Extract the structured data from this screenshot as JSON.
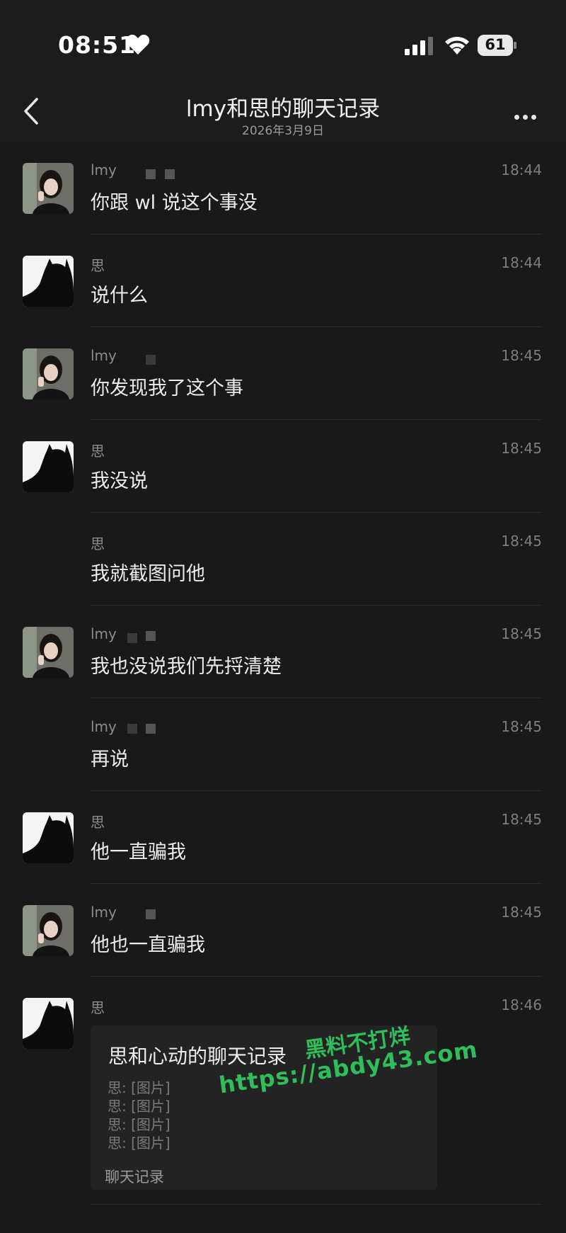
{
  "status_bar": {
    "time": "08:51",
    "battery": "61"
  },
  "header": {
    "title": "lmy和思的聊天记录",
    "date": "2026年3月9日"
  },
  "messages": [
    {
      "sender": "lmy",
      "time": "18:44",
      "text": "你跟 wl 说这个事没"
    },
    {
      "sender": "思",
      "time": "18:44",
      "text": "说什么"
    },
    {
      "sender": "lmy",
      "time": "18:45",
      "text": "你发现我了这个事"
    },
    {
      "sender": "思",
      "time": "18:45",
      "text": "我没说"
    },
    {
      "sender": "思",
      "time": "18:45",
      "text": "我就截图问他"
    },
    {
      "sender": "lmy",
      "time": "18:45",
      "text": "我也没说我们先捋清楚"
    },
    {
      "sender": "lmy",
      "time": "18:45",
      "text": "再说"
    },
    {
      "sender": "思",
      "time": "18:45",
      "text": "他一直骗我"
    },
    {
      "sender": "lmy",
      "time": "18:45",
      "text": "他也一直骗我"
    },
    {
      "sender": "思",
      "time": "18:46",
      "text": ""
    }
  ],
  "forwarded": {
    "title": "思和心动的聊天记录",
    "lines": [
      "思: [图片]",
      "思: [图片]",
      "思: [图片]",
      "思: [图片]"
    ],
    "footer": "聊天记录"
  },
  "watermark": {
    "line1": "黑料不打烊",
    "line2": "https://abdy43.com"
  }
}
